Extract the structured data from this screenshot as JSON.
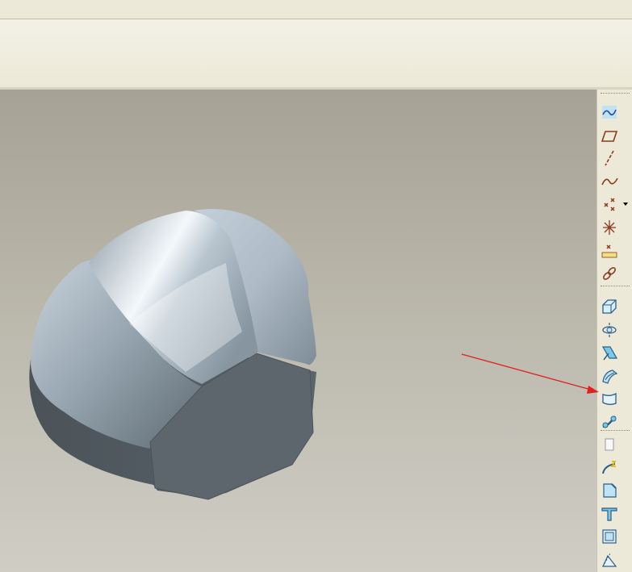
{
  "window": {
    "title": ""
  },
  "viewport": {
    "model": "solid-part-3d",
    "background_top": "#a6a295",
    "background_bottom": "#cfcdc4"
  },
  "annotation": {
    "color": "#e02020",
    "points_to": "tool-boundary-blend"
  },
  "toolbar": {
    "groups": [
      [
        "sketch-curve-icon",
        "datum-plane-icon",
        "datum-axis-icon",
        "datum-curve-icon",
        "datum-point-icon",
        "datum-csys-icon",
        "analysis-icon",
        "chain-icon"
      ],
      [
        "extrude-icon",
        "revolve-icon",
        "sweep-icon",
        "swept-blend-icon",
        "boundary-blend-icon",
        "variable-section-sweep-icon"
      ],
      [
        "hole-icon",
        "round-icon",
        "chamfer-icon",
        "rib-icon",
        "shell-icon",
        "draft-icon"
      ]
    ],
    "flyout_on": "datum-point-icon"
  }
}
